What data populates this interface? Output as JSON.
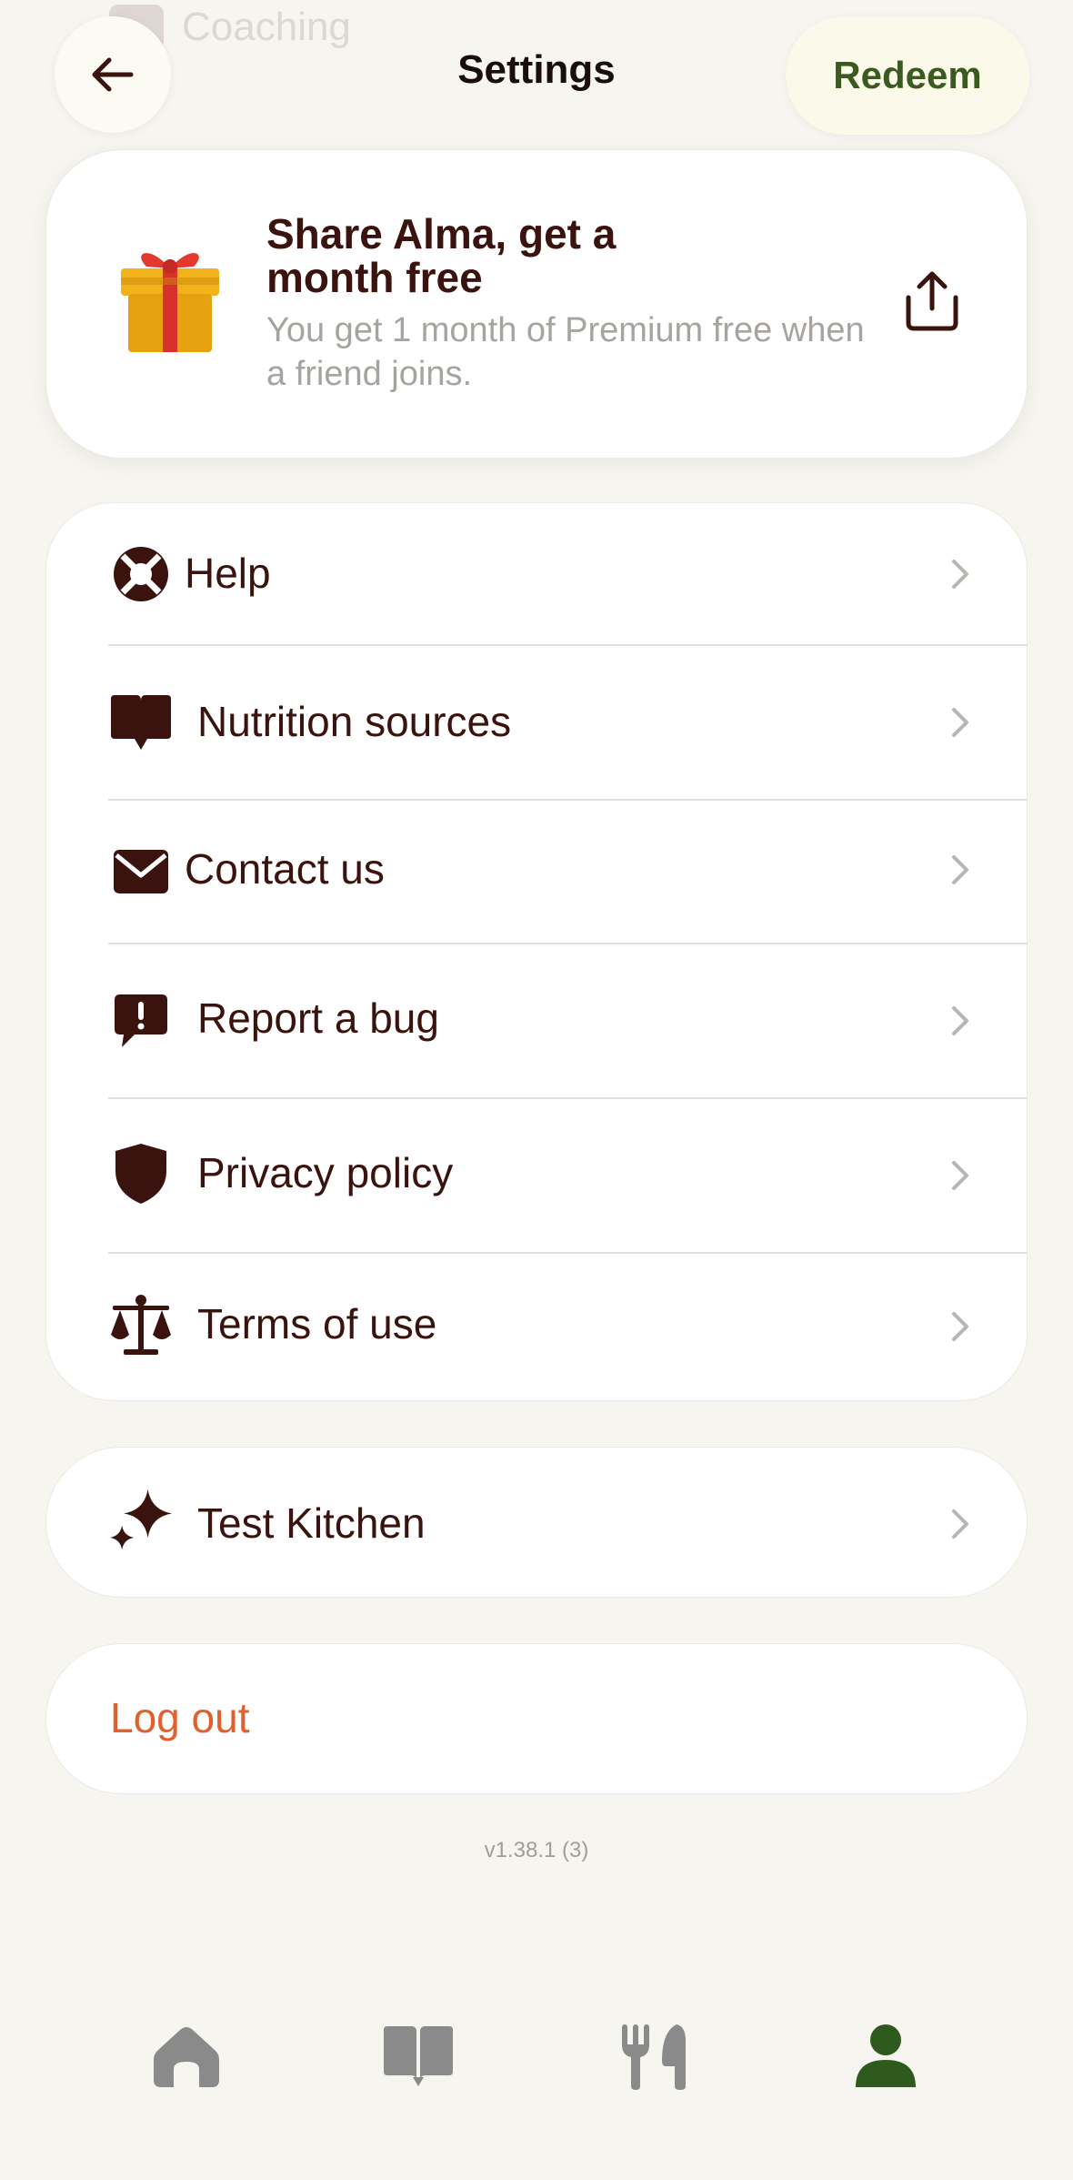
{
  "background_row": {
    "label": "Coaching",
    "icon": "coaching-icon"
  },
  "header": {
    "title": "Settings",
    "back_icon": "arrow-left-icon",
    "redeem_label": "Redeem"
  },
  "share_card": {
    "title": "Share Alma, get a month free",
    "subtitle": "You get 1 month of Premium free when a friend joins.",
    "gift_icon": "gift-icon",
    "share_icon": "share-icon"
  },
  "menu": {
    "items": [
      {
        "label": "Help",
        "icon": "lifebuoy-icon"
      },
      {
        "label": "Nutrition sources",
        "icon": "book-icon"
      },
      {
        "label": "Contact us",
        "icon": "envelope-icon"
      },
      {
        "label": "Report a bug",
        "icon": "alert-bubble-icon"
      },
      {
        "label": "Privacy policy",
        "icon": "shield-icon"
      },
      {
        "label": "Terms of use",
        "icon": "scales-icon"
      }
    ]
  },
  "test_kitchen": {
    "label": "Test Kitchen",
    "icon": "sparkle-icon"
  },
  "logout": {
    "label": "Log out"
  },
  "version": "v1.38.1 (3)",
  "tabbar": {
    "tabs": [
      {
        "name": "home",
        "icon": "home-icon",
        "active": false
      },
      {
        "name": "learn",
        "icon": "open-book-icon",
        "active": false
      },
      {
        "name": "meals",
        "icon": "fork-knife-icon",
        "active": false
      },
      {
        "name": "profile",
        "icon": "person-icon",
        "active": true
      }
    ]
  },
  "colors": {
    "background": "#f7f5f0",
    "text_primary": "#3a130e",
    "accent_green": "#3c5a1f",
    "logout_orange": "#e0612f",
    "muted": "#a7a4a0",
    "tab_inactive": "#8a8a8a"
  }
}
